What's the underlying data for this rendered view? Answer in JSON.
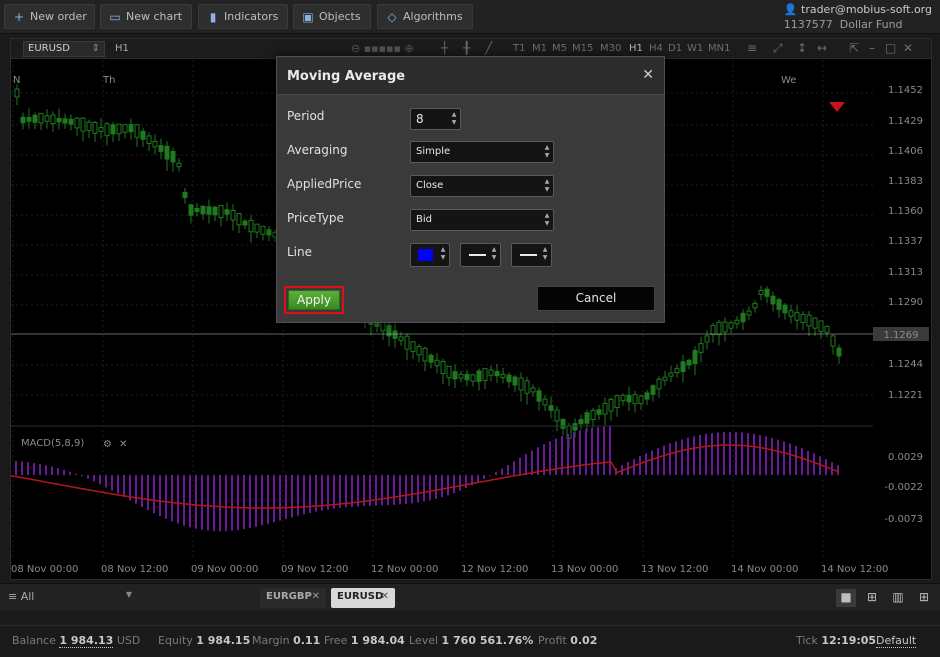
{
  "toolbar": {
    "buttons": [
      {
        "label": "New order",
        "icon": "plus-icon"
      },
      {
        "label": "New chart",
        "icon": "chart-icon"
      },
      {
        "label": "Indicators",
        "icon": "bar-chart-icon"
      },
      {
        "label": "Objects",
        "icon": "shapes-icon"
      },
      {
        "label": "Algorithms",
        "icon": "diamond-icon"
      }
    ]
  },
  "account": {
    "user": "trader@mobius-soft.org",
    "id": "1137577",
    "fund": "Dollar Fund"
  },
  "chart": {
    "symbol": "EURUSD",
    "timeframe": "H1",
    "timeframes": [
      "T1",
      "M1",
      "M5",
      "M15",
      "M30",
      "H1",
      "H4",
      "D1",
      "W1",
      "MN1"
    ],
    "day_markers": [
      "Th",
      "We"
    ],
    "price_ticks": [
      "1.1452",
      "1.1429",
      "1.1406",
      "1.1383",
      "1.1360",
      "1.1337",
      "1.1313",
      "1.1290",
      "1.1244",
      "1.1221"
    ],
    "current_price": "1.1269",
    "macd_label": "MACD(5,8,9)",
    "macd_ticks": [
      "0.0029",
      "-0.0022",
      "-0.0073"
    ],
    "time_ticks": [
      "08 Nov 00:00",
      "08 Nov 12:00",
      "09 Nov 00:00",
      "09 Nov 12:00",
      "12 Nov 00:00",
      "12 Nov 12:00",
      "13 Nov 00:00",
      "13 Nov 12:00",
      "14 Nov 00:00",
      "14 Nov 12:00"
    ],
    "colors": {
      "bull": "#1f7a1f",
      "bear": "#1f7a1f",
      "histogram": "#6a1a9a",
      "signal": "#b01818",
      "price_line": "#cccccc"
    }
  },
  "dialog": {
    "title": "Moving Average",
    "period_label": "Period",
    "period_value": "8",
    "averaging_label": "Averaging",
    "averaging_value": "Simple",
    "applied_price_label": "AppliedPrice",
    "applied_price_value": "Close",
    "price_type_label": "PriceType",
    "price_type_value": "Bid",
    "line_label": "Line",
    "line_color": "#0000ff",
    "apply_label": "Apply",
    "cancel_label": "Cancel"
  },
  "tabs": {
    "filter": "All",
    "symbols": [
      {
        "label": "EURGBP",
        "active": false
      },
      {
        "label": "EURUSD",
        "active": true
      }
    ]
  },
  "status": {
    "balance_label": "Balance",
    "balance_value": "1 984.13",
    "balance_currency": "USD",
    "equity_label": "Equity",
    "equity_value": "1 984.15",
    "margin_label": "Margin",
    "margin_value": "0.11",
    "free_label": "Free",
    "free_value": "1 984.04",
    "level_label": "Level",
    "level_value": "1 760 561.76%",
    "profit_label": "Profit",
    "profit_value": "0.02",
    "tick_label": "Tick",
    "tick_value": "12:19:05",
    "profile_value": "Default"
  }
}
